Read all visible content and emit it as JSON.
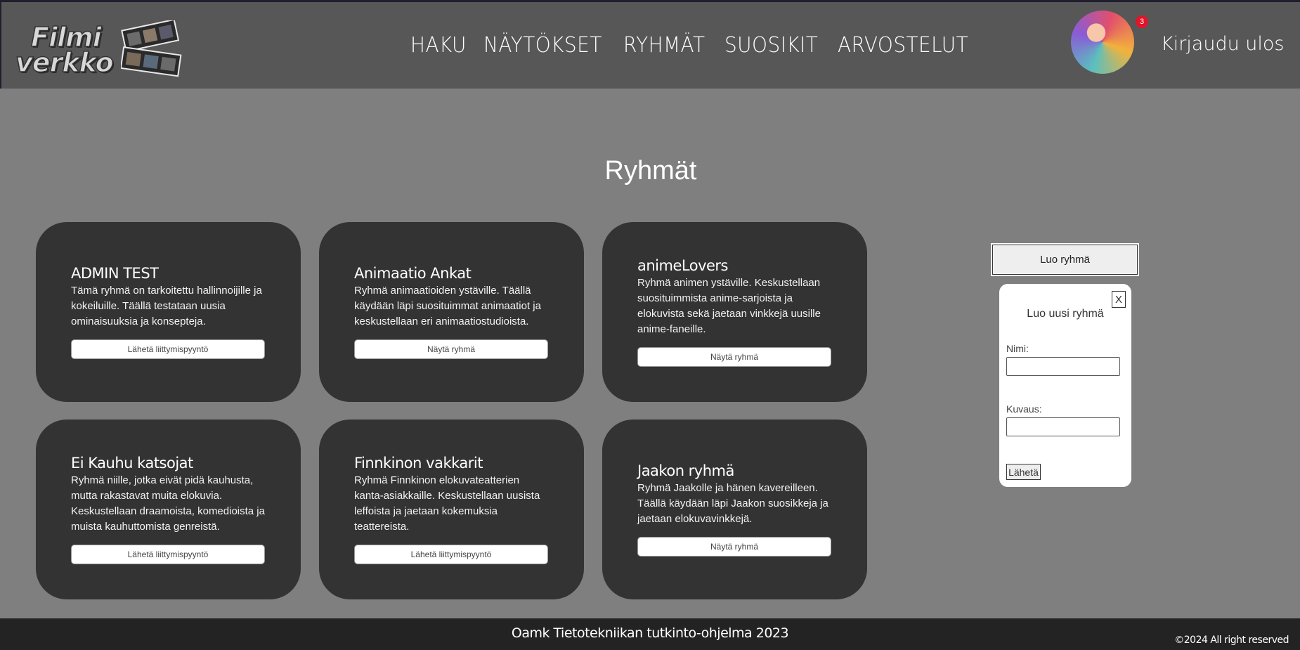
{
  "header": {
    "logo_line1": "Filmi",
    "logo_line2": "verkko",
    "nav": [
      "HAKU",
      "NÄYTÖKSET",
      "RYHMÄT",
      "SUOSIKIT",
      "ARVOSTELUT"
    ],
    "notification_count": "3",
    "logout_label": "Kirjaudu ulos"
  },
  "main": {
    "title": "Ryhmät",
    "groups": [
      {
        "name": "ADMIN TEST",
        "description": "Tämä ryhmä on tarkoitettu hallinnoijille ja kokeiluille. Täällä testataan uusia ominaisuuksia ja konsepteja.",
        "action": "Lähetä liittymispyyntö"
      },
      {
        "name": "Animaatio Ankat",
        "description": "Ryhmä animaatioiden ystäville. Täällä käydään läpi suosituimmat animaatiot ja keskustellaan eri animaatiostudioista.",
        "action": "Näytä ryhmä"
      },
      {
        "name": "animeLovers",
        "description": "Ryhmä animen ystäville. Keskustellaan suosituimmista anime-sarjoista ja elokuvista sekä jaetaan vinkkejä uusille anime-faneille.",
        "action": "Näytä ryhmä"
      },
      {
        "name": "Ei Kauhu katsojat",
        "description": "Ryhmä niille, jotka eivät pidä kauhusta, mutta rakastavat muita elokuvia. Keskustellaan draamoista, komedioista ja muista kauhuttomista genreistä.",
        "action": "Lähetä liittymispyyntö"
      },
      {
        "name": "Finnkinon vakkarit",
        "description": "Ryhmä Finnkinon elokuvateatterien kanta-asiakkaille. Keskustellaan uusista leffoista ja jaetaan kokemuksia teattereista.",
        "action": "Lähetä liittymispyyntö"
      },
      {
        "name": "Jaakon ryhmä",
        "description": "Ryhmä Jaakolle ja hänen kavereilleen. Täällä käydään läpi Jaakon suosikkeja ja jaetaan elokuvavinkkejä.",
        "action": "Näytä ryhmä"
      }
    ]
  },
  "sidebar": {
    "create_button": "Luo ryhmä",
    "modal": {
      "close_label": "X",
      "title": "Luo uusi ryhmä",
      "name_label": "Nimi:",
      "name_value": "",
      "description_label": "Kuvaus:",
      "description_value": "",
      "submit_label": "Lähetä"
    }
  },
  "footer": {
    "center_text": "Oamk Tietotekniikan tutkinto-ohjelma 2023",
    "copyright": "©2024 All right reserved"
  },
  "colors": {
    "page_bg": "#7f7f7f",
    "header_bg": "#575757",
    "card_bg": "#333333",
    "footer_bg": "#232323",
    "badge": "#e0142a"
  }
}
